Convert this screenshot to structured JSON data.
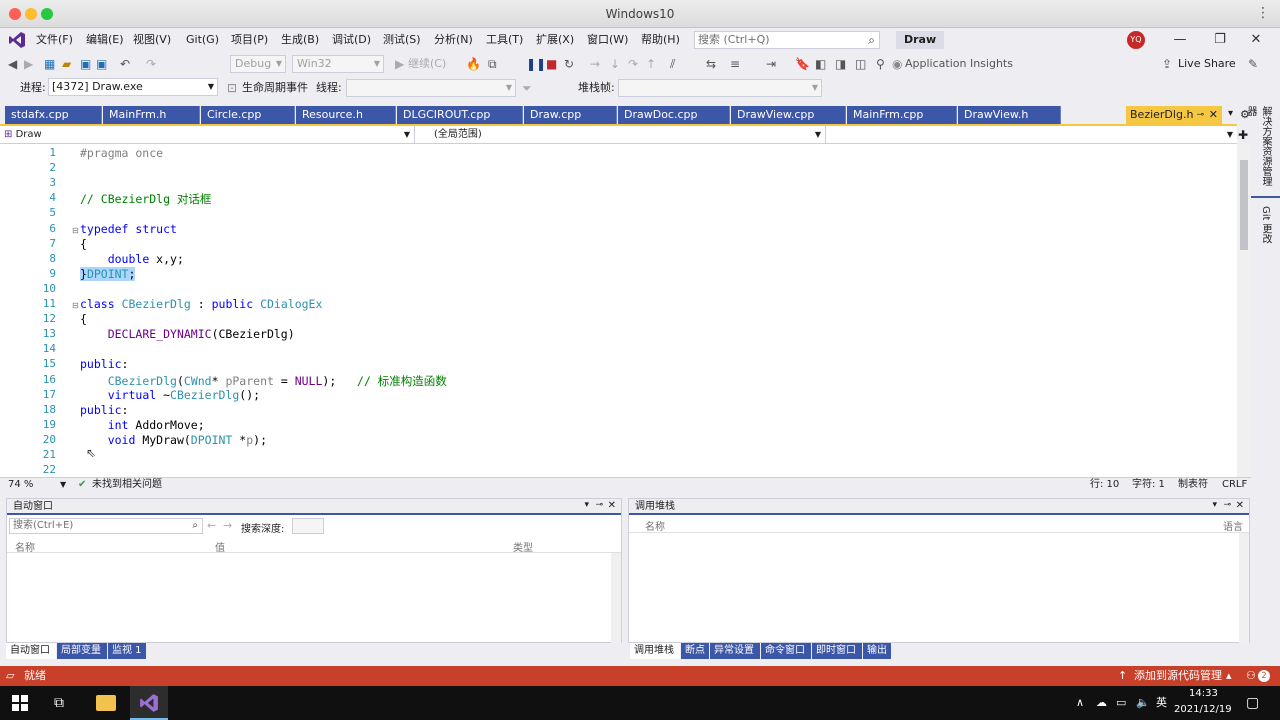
{
  "mac_title": "Windows10",
  "menu": [
    "文件(F)",
    "编辑(E)",
    "视图(V)",
    "Git(G)",
    "项目(P)",
    "生成(B)",
    "调试(D)",
    "测试(S)",
    "分析(N)",
    "工具(T)",
    "扩展(X)",
    "窗口(W)",
    "帮助(H)"
  ],
  "search_placeholder": "搜索 (Ctrl+Q)",
  "solution_name": "Draw",
  "avatar_initials": "YQ",
  "toolbar": {
    "config": "Debug",
    "platform": "Win32",
    "continue": "继续(C)",
    "app_insights": "Application Insights",
    "live_share": "Live Share"
  },
  "debugbar": {
    "process_label": "进程:",
    "process_value": "[4372] Draw.exe",
    "lifecycle": "生命周期事件",
    "thread_label": "线程:",
    "stackframe_label": "堆栈帧:"
  },
  "tabs": [
    "stdafx.cpp",
    "MainFrm.h",
    "Circle.cpp",
    "Resource.h",
    "DLGCIROUT.cpp",
    "Draw.cpp",
    "DrawDoc.cpp",
    "DrawView.cpp",
    "MainFrm.cpp",
    "DrawView.h"
  ],
  "active_tab": "BezierDlg.h",
  "nav": {
    "project": "Draw",
    "scope": "(全局范围)"
  },
  "side_tabs": [
    "解决方案资源管理器",
    "Git 更改"
  ],
  "code_lines": [
    {
      "n": "1",
      "t": "#pragma once"
    },
    {
      "n": "2",
      "t": ""
    },
    {
      "n": "3",
      "t": ""
    },
    {
      "n": "4",
      "t": "// CBezierDlg 对话框"
    },
    {
      "n": "5",
      "t": ""
    },
    {
      "n": "6",
      "t": "typedef struct"
    },
    {
      "n": "7",
      "t": "{"
    },
    {
      "n": "8",
      "t": "    double x,y;"
    },
    {
      "n": "9",
      "t": "}DPOINT;"
    },
    {
      "n": "10",
      "t": ""
    },
    {
      "n": "11",
      "t": "class CBezierDlg : public CDialogEx"
    },
    {
      "n": "12",
      "t": "{"
    },
    {
      "n": "13",
      "t": "    DECLARE_DYNAMIC(CBezierDlg)"
    },
    {
      "n": "14",
      "t": ""
    },
    {
      "n": "15",
      "t": "public:"
    },
    {
      "n": "16",
      "t": "    CBezierDlg(CWnd* pParent = NULL);   // 标准构造函数"
    },
    {
      "n": "17",
      "t": "    virtual ~CBezierDlg();"
    },
    {
      "n": "18",
      "t": "public:"
    },
    {
      "n": "19",
      "t": "    int AddorMove;"
    },
    {
      "n": "20",
      "t": "    void MyDraw(DPOINT *p);"
    },
    {
      "n": "21",
      "t": ""
    },
    {
      "n": "22",
      "t": ""
    }
  ],
  "editor_status": {
    "zoom": "74 %",
    "issues": "未找到相关问题",
    "line": "行: 10",
    "col": "字符: 1",
    "tab": "制表符",
    "eol": "CRLF"
  },
  "autos": {
    "title": "自动窗口",
    "search_placeholder": "搜索(Ctrl+E)",
    "depth_label": "搜索深度:",
    "columns": [
      "名称",
      "值",
      "类型"
    ],
    "bottom_tabs": [
      "自动窗口",
      "局部变量",
      "监视 1"
    ]
  },
  "callstack": {
    "title": "调用堆栈",
    "columns": [
      "名称",
      "语言"
    ],
    "bottom_tabs": [
      "调用堆栈",
      "断点",
      "异常设置",
      "命令窗口",
      "即时窗口",
      "输出"
    ]
  },
  "statusbar": {
    "ready": "就绪",
    "source_control": "添加到源代码管理",
    "badge": "2"
  },
  "taskbar": {
    "ime": "英",
    "time": "14:33",
    "date": "2021/12/19"
  }
}
